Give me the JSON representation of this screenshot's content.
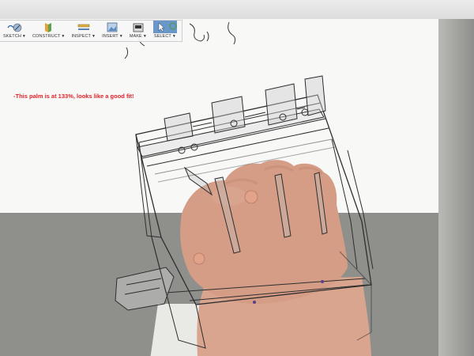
{
  "toolbar": {
    "items": [
      {
        "label": "SKETCH",
        "icon": "sketch-icon"
      },
      {
        "label": "CONSTRUCT",
        "icon": "construct-plane-icon"
      },
      {
        "label": "INSPECT",
        "icon": "inspect-measure-icon"
      },
      {
        "label": "INSERT",
        "icon": "insert-image-icon"
      },
      {
        "label": "MAKE",
        "icon": "make-print-icon"
      },
      {
        "label": "SELECT",
        "icon": "select-cursor-icon"
      }
    ],
    "caret": "▼"
  },
  "annotation": {
    "text": "-This palm is at 133%, looks like a good fit!",
    "color": "#e3222a"
  },
  "colors": {
    "select_active": "#6a96c8",
    "annotation": "#e3222a"
  }
}
